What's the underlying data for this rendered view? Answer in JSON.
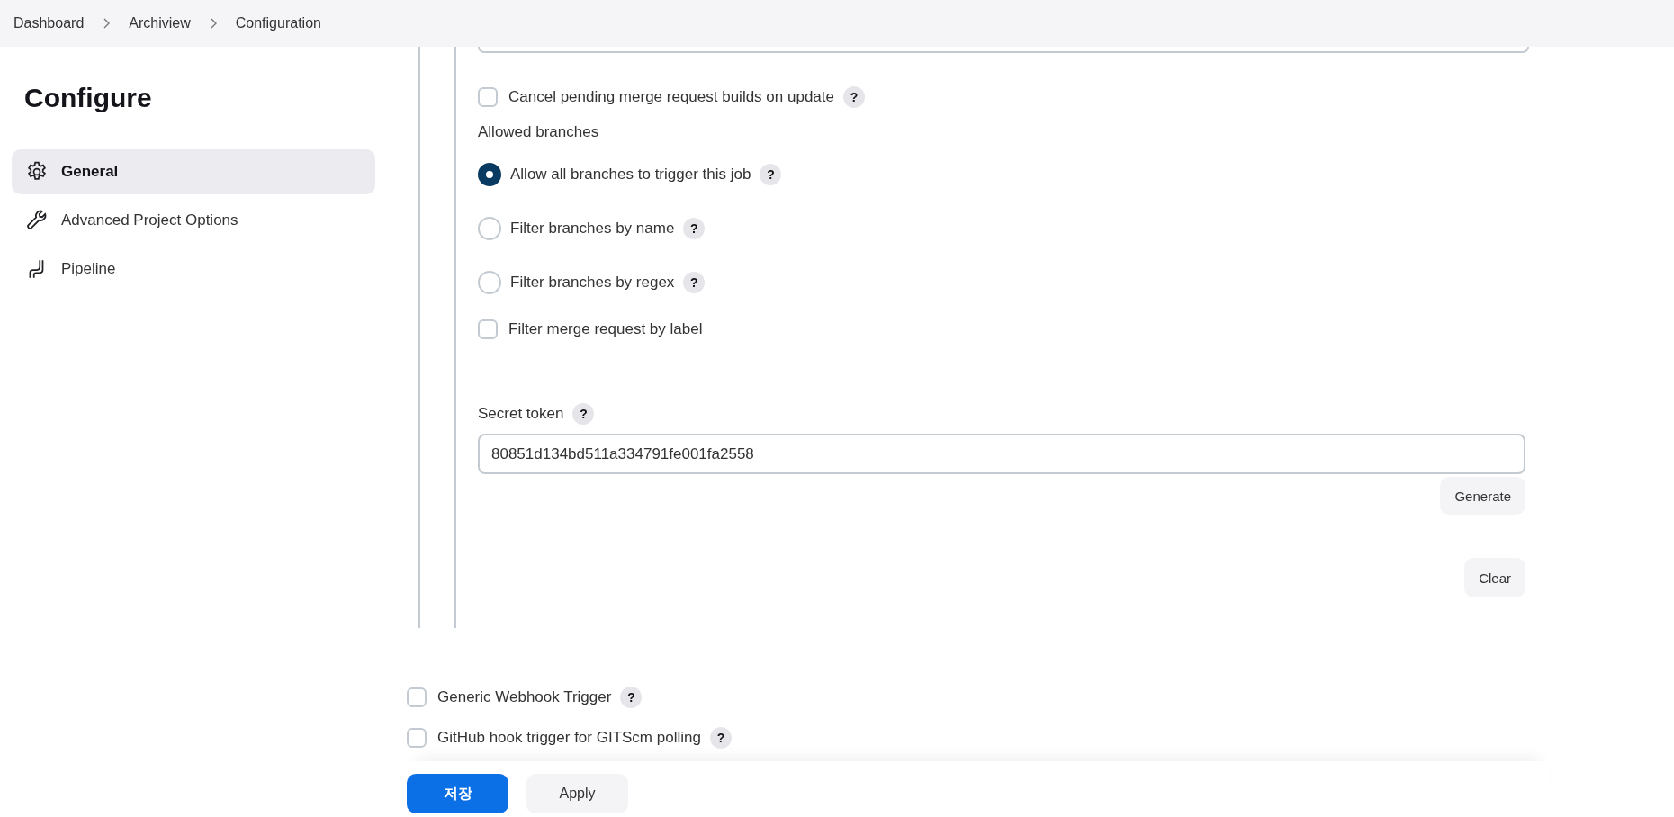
{
  "breadcrumbs": [
    "Dashboard",
    "Archiview",
    "Configuration"
  ],
  "sidebar": {
    "title": "Configure",
    "items": [
      {
        "label": "General",
        "kind": "gear",
        "selected": true
      },
      {
        "label": "Advanced Project Options",
        "kind": "wrench",
        "selected": false
      },
      {
        "label": "Pipeline",
        "kind": "pipeline",
        "selected": false
      }
    ]
  },
  "gitlab_options": [
    {
      "kind": "checkbox",
      "label": "Cancel pending merge request builds on update",
      "checked": false,
      "help": "?"
    },
    {
      "kind": "heading",
      "label": "Allowed branches"
    },
    {
      "kind": "radio",
      "label": "Allow all branches to trigger this job",
      "selected": true,
      "help": "?"
    },
    {
      "kind": "radio",
      "label": "Filter branches by name",
      "selected": false,
      "help": "?"
    },
    {
      "kind": "radio",
      "label": "Filter branches by regex",
      "selected": false,
      "help": "?"
    },
    {
      "kind": "checkbox",
      "label": "Filter merge request by label",
      "checked": false
    }
  ],
  "secret_token": {
    "label": "Secret token",
    "help": "?",
    "value": "80851d134bd511a334791fe001fa2558",
    "buttons": [
      "Generate",
      "Clear"
    ]
  },
  "triggers": [
    {
      "label": "Generic Webhook Trigger",
      "checked": false,
      "help": "?"
    },
    {
      "label": "GitHub hook trigger for GITScm polling",
      "checked": false,
      "help": "?"
    }
  ],
  "buttons": [
    {
      "label": "저장",
      "kind": "primary"
    },
    {
      "label": "Apply",
      "kind": "secondary"
    }
  ]
}
